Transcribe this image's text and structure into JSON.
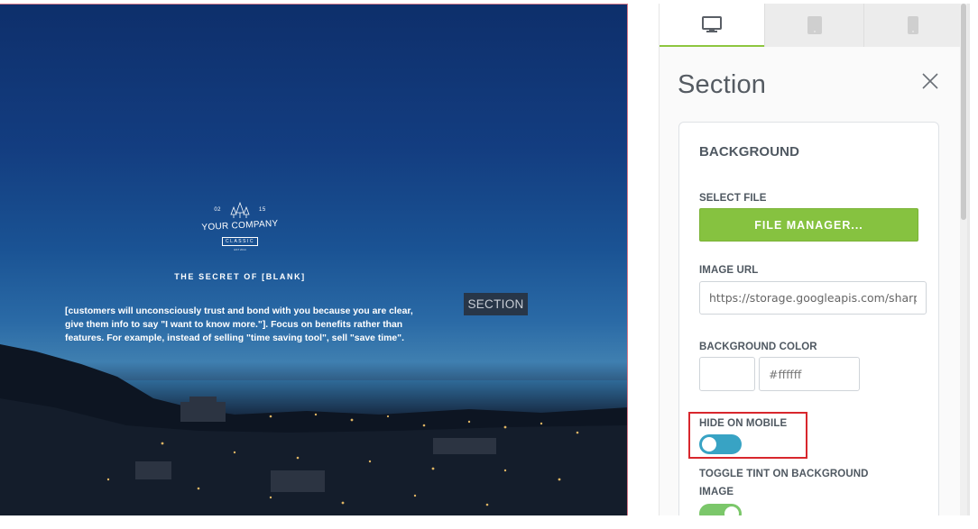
{
  "canvas": {
    "logo": {
      "left_number": "02",
      "right_number": "15",
      "company": "YOUR COMPANY",
      "tagline": "CLASSIC",
      "tiny": "EST 2014"
    },
    "kicker": "THE SECRET OF [BLANK]",
    "body_copy": "[customers will unconsciously trust and bond with you because you are clear, give them info to say \"I want to know more.\"]. Focus on benefits rather than features. For example, instead of selling \"time saving tool\", sell \"save time\".",
    "section_tag": "SECTION"
  },
  "panel": {
    "device_tabs": [
      {
        "name": "desktop",
        "icon": "desktop-icon",
        "active": true
      },
      {
        "name": "tablet",
        "icon": "tablet-icon",
        "active": false
      },
      {
        "name": "mobile",
        "icon": "mobile-icon",
        "active": false
      }
    ],
    "title": "Section",
    "background": {
      "heading": "BACKGROUND",
      "select_file_label": "SELECT FILE",
      "file_manager_label": "FILE MANAGER...",
      "image_url_label": "IMAGE URL",
      "image_url_value": "https://storage.googleapis.com/sharpspring",
      "background_color_label": "BACKGROUND COLOR",
      "background_color_value": "#ffffff",
      "hide_on_mobile_label": "HIDE ON MOBILE",
      "hide_on_mobile_on": false,
      "toggle_tint_label_line1": "TOGGLE TINT ON BACKGROUND",
      "toggle_tint_label_line2": "IMAGE",
      "toggle_tint_on": true
    }
  },
  "colors": {
    "accent_green": "#86c240",
    "toggle_blue": "#38a3c4",
    "highlight_red": "#d8272d"
  }
}
